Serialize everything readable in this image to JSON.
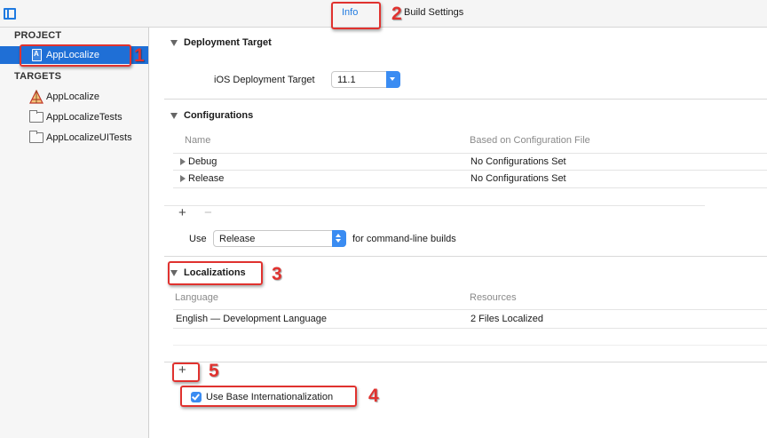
{
  "tabs": {
    "info": "Info",
    "build_settings": "Build Settings"
  },
  "sidebar": {
    "project_header": "PROJECT",
    "project_item": "AppLocalize",
    "targets_header": "TARGETS",
    "targets": [
      "AppLocalize",
      "AppLocalizeTests",
      "AppLocalizeUITests"
    ]
  },
  "deployment": {
    "title": "Deployment Target",
    "ios_label": "iOS Deployment Target",
    "ios_value": "11.1"
  },
  "configurations": {
    "title": "Configurations",
    "columns": [
      "Name",
      "Based on Configuration File"
    ],
    "rows": [
      {
        "name": "Debug",
        "file": "No Configurations Set"
      },
      {
        "name": "Release",
        "file": "No Configurations Set"
      }
    ],
    "plus": "+",
    "minus": "−",
    "use_label": "Use",
    "use_value": "Release",
    "use_suffix": "for command-line builds"
  },
  "localizations": {
    "title": "Localizations",
    "columns": [
      "Language",
      "Resources"
    ],
    "rows": [
      {
        "language": "English — Development Language",
        "resources": "2 Files Localized"
      }
    ],
    "plus": "+",
    "base_checkbox_label": "Use Base Internationalization",
    "base_checked": true
  },
  "annotations": {
    "callout_1": "1",
    "callout_2": "2",
    "callout_3": "3",
    "callout_4": "4",
    "callout_5": "5",
    "color": "#e0322f"
  },
  "colors": {
    "accent": "#1f7ae0",
    "selection": "#1f6fd6"
  }
}
